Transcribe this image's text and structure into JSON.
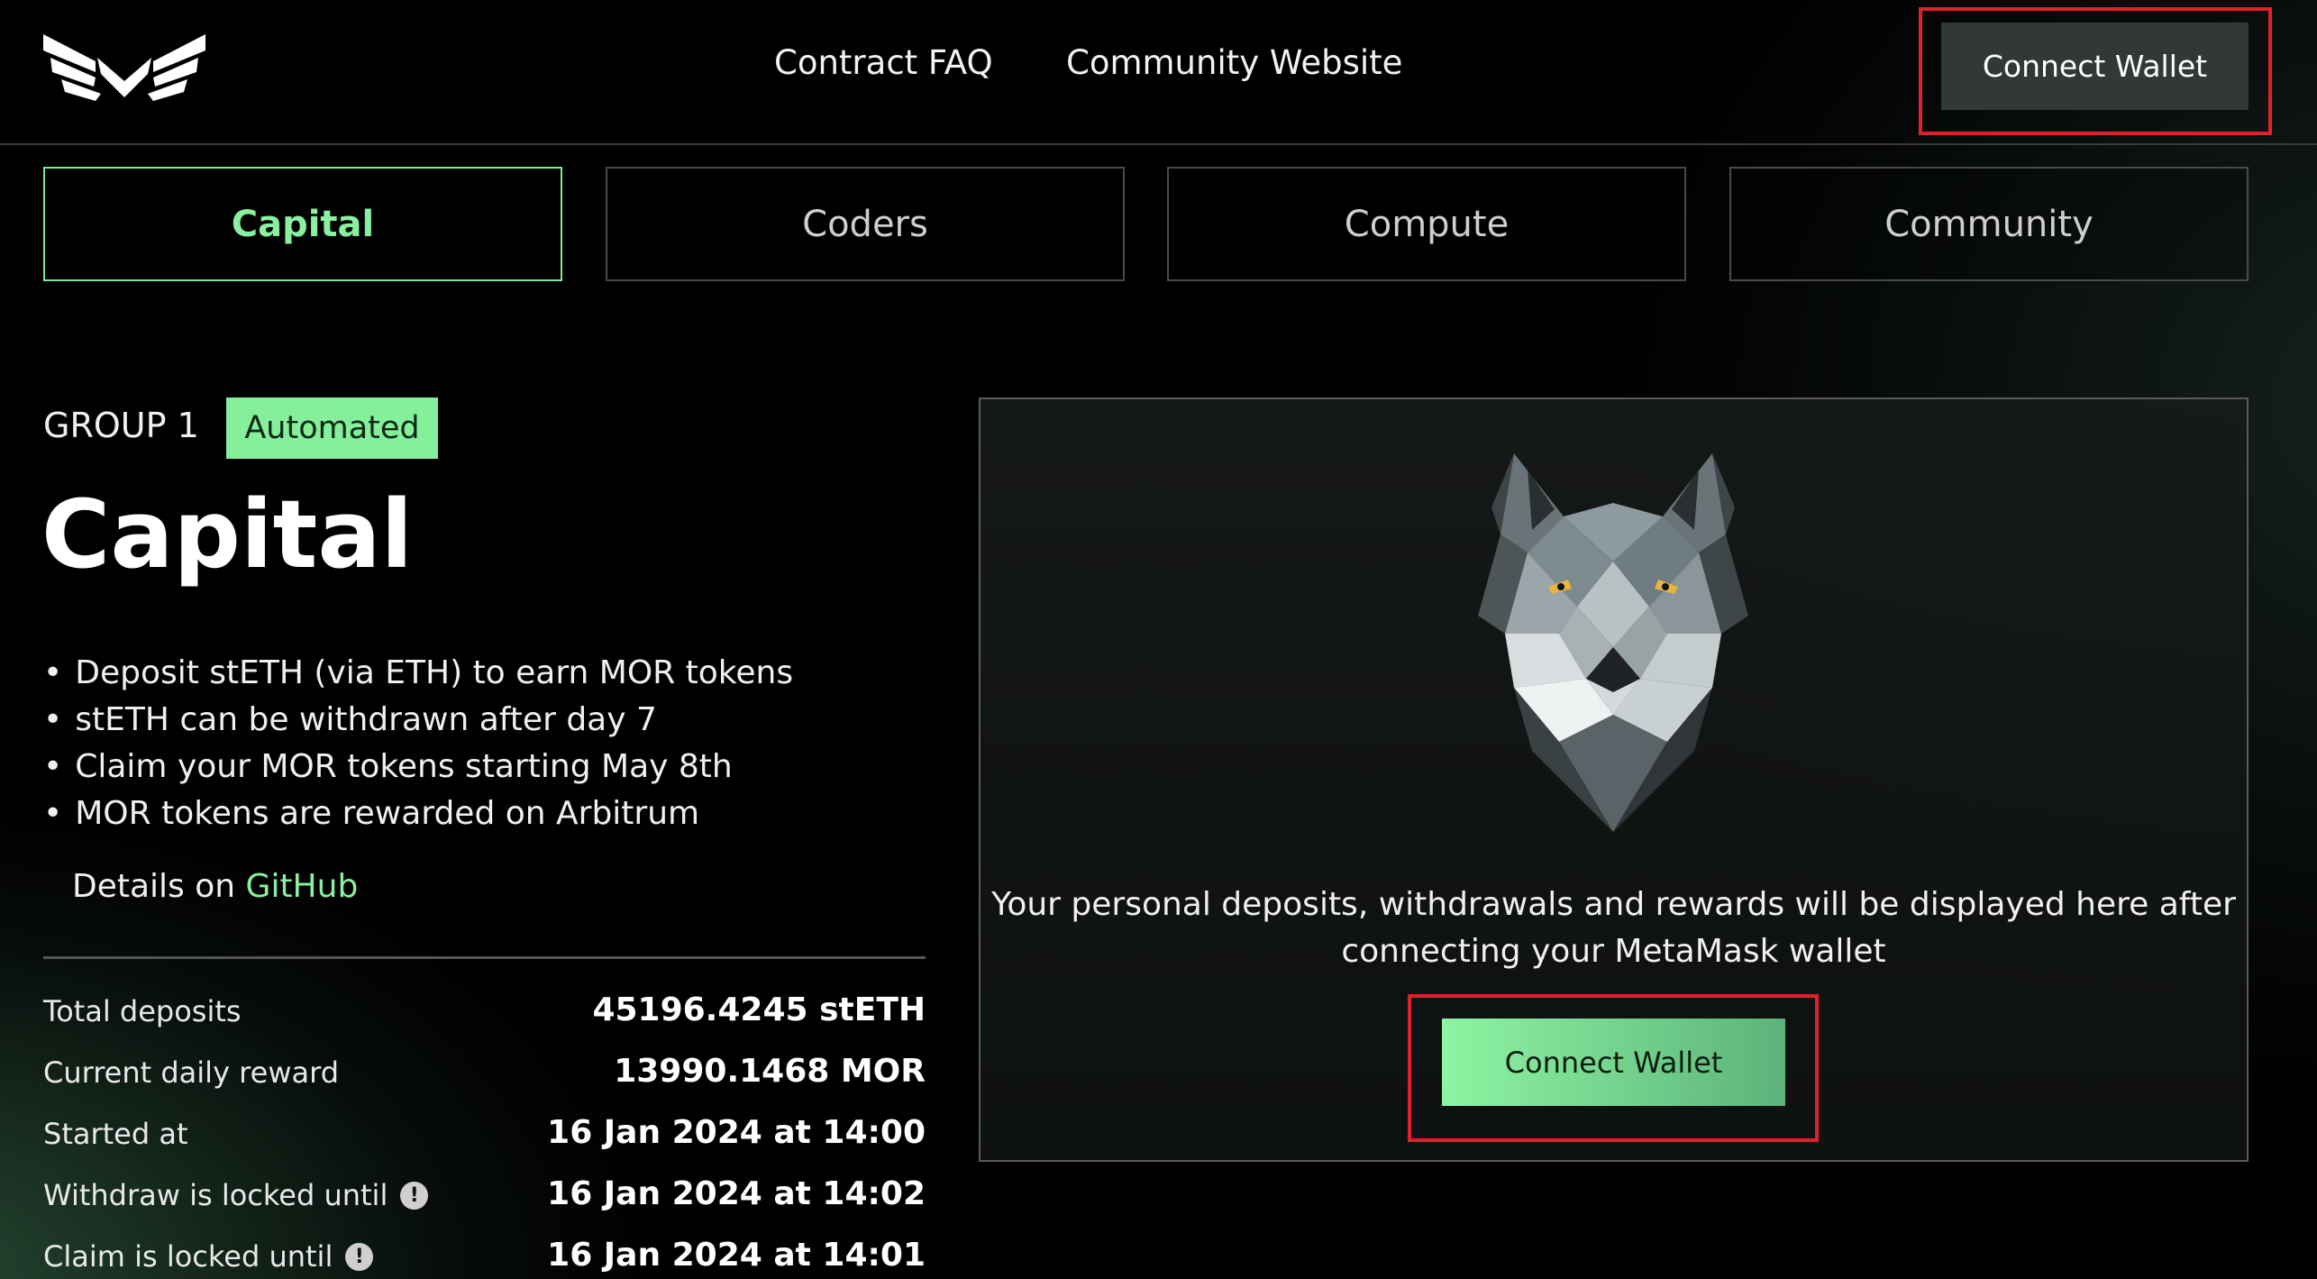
{
  "header": {
    "nav": [
      {
        "label": "Contract FAQ"
      },
      {
        "label": "Community Website"
      }
    ],
    "connect_wallet_label": "Connect Wallet"
  },
  "tabs": [
    {
      "label": "Capital",
      "active": true
    },
    {
      "label": "Coders",
      "active": false
    },
    {
      "label": "Compute",
      "active": false
    },
    {
      "label": "Community",
      "active": false
    }
  ],
  "main": {
    "group_label": "GROUP 1",
    "badge": "Automated",
    "title": "Capital",
    "bullets": [
      "Deposit stETH (via ETH) to earn MOR tokens",
      "stETH can be withdrawn after day 7",
      "Claim your MOR tokens starting May 8th",
      "MOR tokens are rewarded on Arbitrum"
    ],
    "details_prefix": "Details on ",
    "details_link": "GitHub",
    "stats": [
      {
        "label": "Total deposits",
        "value": "45196.4245 stETH",
        "info": false
      },
      {
        "label": "Current daily reward",
        "value": "13990.1468 MOR",
        "info": false
      },
      {
        "label": "Started at",
        "value": "16 Jan 2024 at 14:00",
        "info": false
      },
      {
        "label": "Withdraw is locked until",
        "value": "16 Jan 2024 at 14:02",
        "info": true
      },
      {
        "label": "Claim is locked until",
        "value": "16 Jan 2024 at 14:01",
        "info": true
      }
    ]
  },
  "panel": {
    "message": "Your personal deposits, withdrawals and rewards will be displayed here after connecting your MetaMask wallet",
    "connect_wallet_label": "Connect Wallet"
  },
  "colors": {
    "accent": "#86ef9c",
    "highlight": "#e0202c",
    "background": "#000000"
  },
  "icons": [
    "morpheus-logo-icon",
    "info-icon",
    "wolf-illustration"
  ]
}
